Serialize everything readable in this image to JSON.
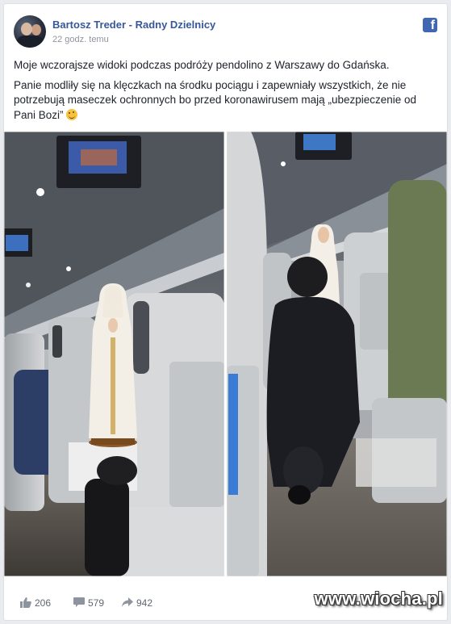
{
  "post": {
    "author": "Bartosz Treder - Radny Dzielnicy",
    "time": "22 godz. temu",
    "paragraph1": "Moje wczorajsze widoki podczas podróży pendolino z Warszawy do Gdańska.",
    "paragraph2": "Panie modliły się na klęczkach na środku pociągu i zapewniały wszystkich, że nie potrzebują maseczek ochronnych bo przed koronawirusem mają „ubezpieczenie od Pani Bozi”",
    "emoji": "smirk-emoji"
  },
  "stats": {
    "likes": "206",
    "comments": "579",
    "shares": "942"
  },
  "watermark": "www.wiocha.pl",
  "colors": {
    "link_blue": "#365899",
    "facebook_blue": "#4267b2",
    "meta_gray": "#90949c",
    "background": "#e9ebee"
  },
  "icons": {
    "brand": "facebook-icon",
    "like": "thumbs-up-icon",
    "comment": "comment-icon",
    "share": "share-arrow-icon"
  }
}
